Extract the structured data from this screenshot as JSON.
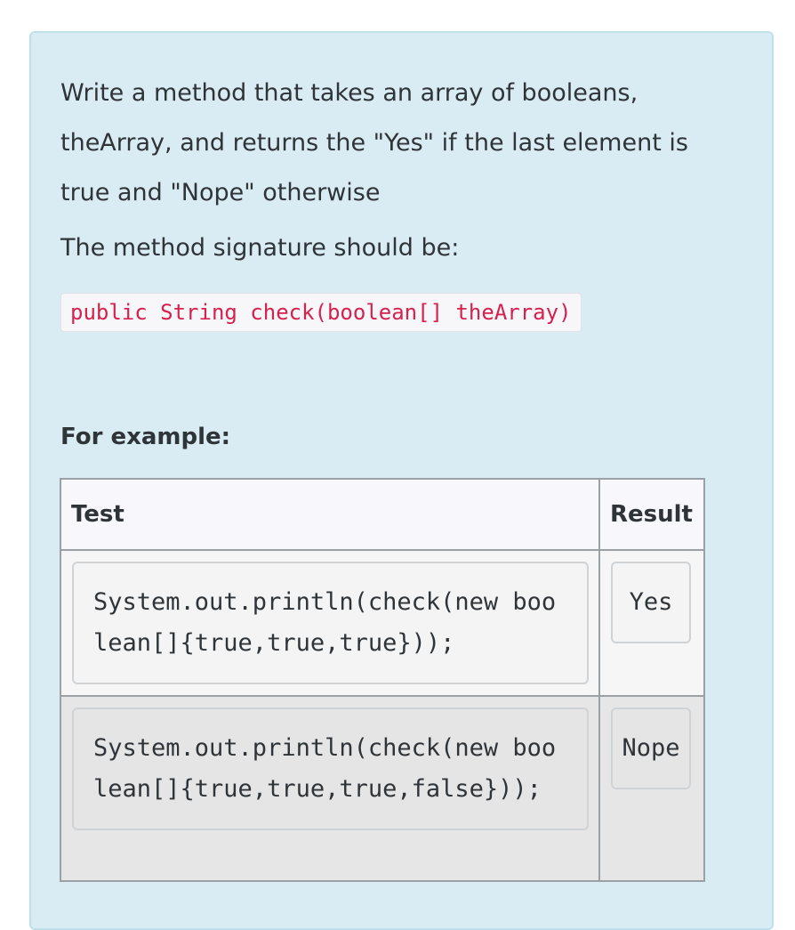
{
  "question": {
    "description": "Write a method that takes an array of booleans, theArray, and returns the \"Yes\" if the last element is true and \"Nope\" otherwise",
    "signature_intro": "The method signature should be:",
    "signature_code": "public String check(boolean[] theArray)"
  },
  "examples": {
    "heading": "For example:",
    "headers": {
      "test": "Test",
      "result": "Result"
    },
    "rows": [
      {
        "test": "System.out.println(check(new boolean[]{true,true,true}));",
        "result": "Yes"
      },
      {
        "test": "System.out.println(check(new boolean[]{true,true,true,false}));",
        "result": "Nope"
      }
    ]
  },
  "colors": {
    "card_background": "#d9ecf3",
    "code_accent": "#d6204e"
  }
}
